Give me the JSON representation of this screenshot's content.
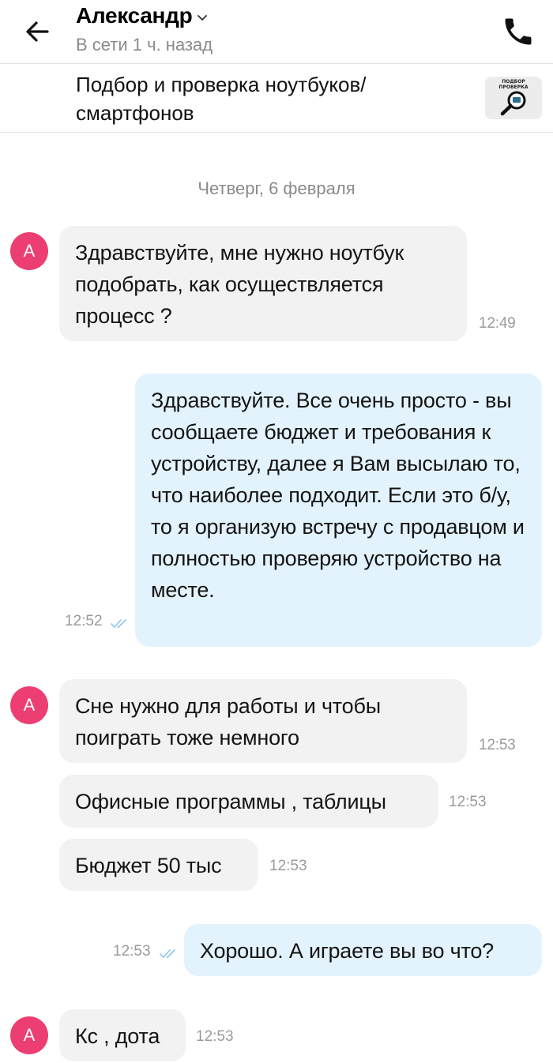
{
  "header": {
    "contact_name": "Александр",
    "status": "В сети 1 ч. назад"
  },
  "listing": {
    "title": "Подбор и проверка ноутбуков/ смартфонов",
    "thumb_line1": "ПОДБОР",
    "thumb_line2": "ПРОВЕРКА"
  },
  "date_separator": "Четверг, 6 февраля",
  "avatar_letter": "А",
  "colors": {
    "avatar": "#ec3e72",
    "incoming_bubble": "#f2f2f2",
    "outgoing_bubble": "#e3f3fd",
    "read_ticks": "#8fc6ea"
  },
  "messages": [
    {
      "direction": "in",
      "text": "Здравствуйте, мне нужно ноутбук подобрать, как осуществляется процесс ?",
      "time": "12:49"
    },
    {
      "direction": "out",
      "text": "Здравствуйте. Все очень просто - вы сообщаете бюджет и требования к устройству, далее я Вам высылаю то, что наиболее подходит. Если это б/у, то я организую встречу с продавцом и полностью проверяю устройство на месте.",
      "time": "12:52",
      "read": true
    },
    {
      "direction": "in",
      "text": "Сне нужно для работы и чтобы поиграть тоже немного",
      "time": "12:53"
    },
    {
      "direction": "in",
      "text": "Офисные программы , таблицы",
      "time": "12:53"
    },
    {
      "direction": "in",
      "text": "Бюджет 50 тыс",
      "time": "12:53"
    },
    {
      "direction": "out",
      "text": "Хорошо. А играете вы во что?",
      "time": "12:53",
      "read": true
    },
    {
      "direction": "in",
      "text": "Кс , дота",
      "time": "12:53"
    }
  ]
}
